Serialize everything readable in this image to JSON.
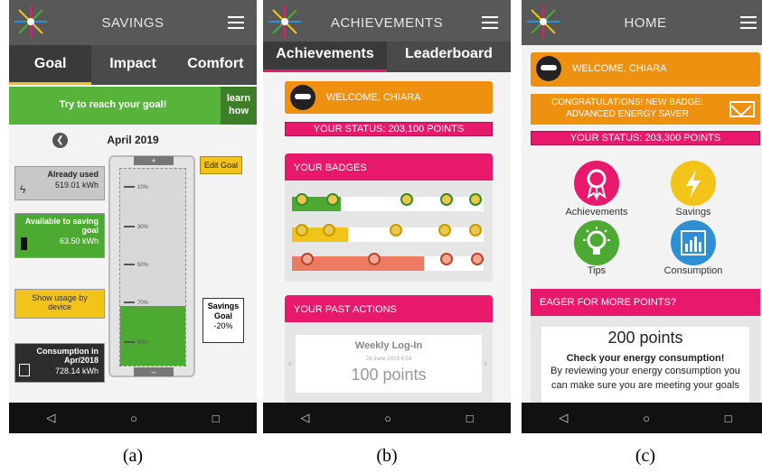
{
  "panel_a": {
    "title": "SAVINGS",
    "tabs": [
      "Goal",
      "Impact",
      "Comfort"
    ],
    "banner": "Try to reach your goal!",
    "learn_label": "learn how",
    "month": "April 2019",
    "back_icon": "chevron-left-icon",
    "already_used_label": "Already used",
    "already_used_value": "519.01 kWh",
    "available_label": "Available to saving goal",
    "available_value": "63.50 kWh",
    "usage_label": "Show usage by device",
    "consumption_label": "Consumption in Apr/2018",
    "consumption_value": "728.14 kWh",
    "edit_goal_label": "Edit Goal",
    "gauge_ticks": [
      "10%",
      "30%",
      "50%",
      "70%",
      "90%"
    ],
    "gauge_plus": "+",
    "gauge_minus": "–",
    "savings_goal_label": "Savings Goal",
    "savings_goal_value": "-20%",
    "caption": "(a)"
  },
  "panel_b": {
    "title": "ACHIEVEMENTS",
    "tabs": [
      "Achievements",
      "Leaderboard"
    ],
    "welcome": "WELCOME, CHIARA",
    "status": "YOUR STATUS: 203,100 POINTS",
    "badges_header": "YOUR BADGES",
    "actions_header": "YOUR PAST ACTIONS",
    "action_title": "Weekly Log-In",
    "action_date": "28-June-2019 6:54",
    "action_points": "100 points",
    "caption": "(b)",
    "colors": {
      "green": "#4caa32",
      "yellow": "#f2c318",
      "salmon": "#ec7b62"
    }
  },
  "panel_c": {
    "title": "HOME",
    "welcome": "WELCOME, CHIARA",
    "congrats": "CONGRATULATIONS! NEW BADGE: ADVANCED ENERGY SAVER",
    "status": "YOUR STATUS: 203,300 POINTS",
    "menu": [
      {
        "label": "Achievements",
        "icon": "ribbon-badge-icon",
        "color": "#e8196d"
      },
      {
        "label": "Savings",
        "icon": "lightning-icon",
        "color": "#f2c318"
      },
      {
        "label": "Tips",
        "icon": "lightbulb-icon",
        "color": "#4caa32"
      },
      {
        "label": "Consumption",
        "icon": "bar-chart-icon",
        "color": "#2e8fd6"
      }
    ],
    "eager_header": "EAGER FOR MORE POINTS?",
    "eager_points": "200 points",
    "eager_title": "Check your energy consumption!",
    "eager_text": "By reviewing your energy consumption you can make sure you are meeting your goals",
    "caption": "(c)"
  },
  "nav": {
    "back": "◁",
    "home": "○",
    "recent": "□"
  }
}
